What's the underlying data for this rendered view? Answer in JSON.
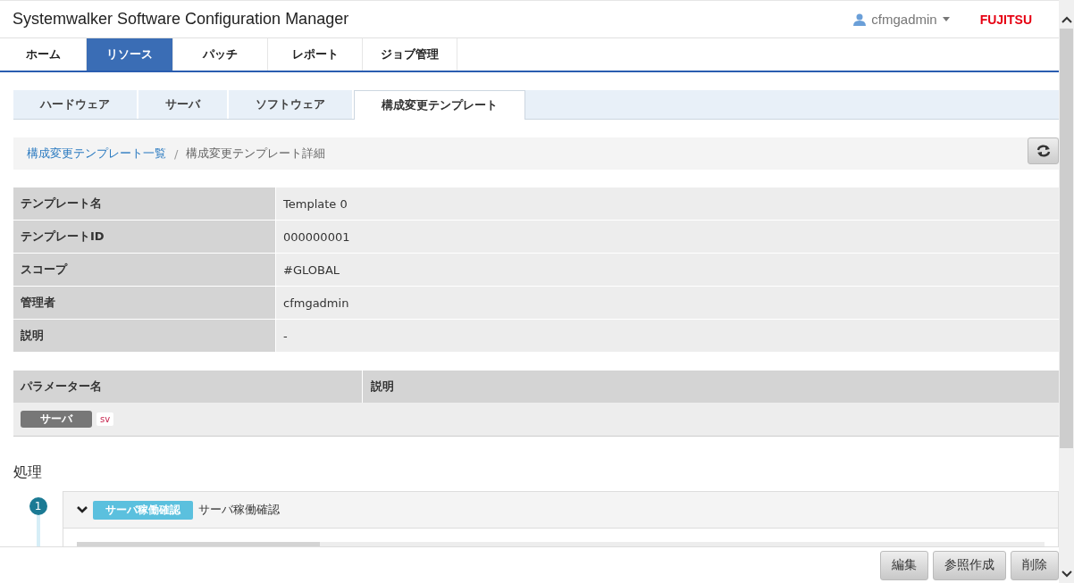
{
  "header": {
    "title": "Systemwalker Software Configuration Manager",
    "user": "cfmgadmin",
    "logo": "FUJITSU"
  },
  "main_tabs": [
    {
      "label": "ホーム",
      "selected": false
    },
    {
      "label": "リソース",
      "selected": true
    },
    {
      "label": "パッチ",
      "selected": false
    },
    {
      "label": "レポート",
      "selected": false
    },
    {
      "label": "ジョブ管理",
      "selected": false
    }
  ],
  "sub_tabs": [
    {
      "label": "ハードウェア",
      "selected": false
    },
    {
      "label": "サーバ",
      "selected": false
    },
    {
      "label": "ソフトウェア",
      "selected": false
    },
    {
      "label": "構成変更テンプレート",
      "selected": true
    }
  ],
  "breadcrumb_separator": "/",
  "breadcrumb": [
    {
      "label": "構成変更テンプレート一覧",
      "kind": "link"
    },
    {
      "label": "構成変更テンプレート詳細",
      "kind": "current"
    }
  ],
  "details": [
    {
      "label": "テンプレート名",
      "value": "Template 0"
    },
    {
      "label": "テンプレートID",
      "value": "000000001"
    },
    {
      "label": "スコープ",
      "value": "#GLOBAL"
    },
    {
      "label": "管理者",
      "value": "cfmgadmin"
    },
    {
      "label": "説明",
      "value": "-"
    }
  ],
  "parameters": {
    "columns": [
      "パラメーター名",
      "説明"
    ],
    "rows": [
      {
        "tag": "サーバ",
        "code": "sv"
      }
    ]
  },
  "process": {
    "heading": "処理",
    "steps": [
      {
        "number": "1",
        "expanded": true,
        "tag": "サーバ稼働確認",
        "name": "サーバ稼働確認"
      }
    ]
  },
  "buttons": [
    "編集",
    "参照作成",
    "削除"
  ]
}
